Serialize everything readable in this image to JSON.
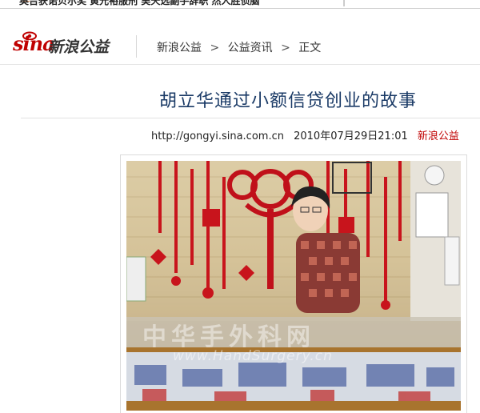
{
  "topbar": {
    "ticker": "奥吉获诺贝尔奖  黄光裕服刑  吴天选副手辞职  然人胜侦脑"
  },
  "header": {
    "logo_brand": "sina",
    "logo_cn": "新浪公益",
    "breadcrumb": {
      "home": "新浪公益",
      "sep1": ">",
      "section": "公益资讯",
      "sep2": ">",
      "current": "正文"
    }
  },
  "article": {
    "title": "胡立华通过小额信贷创业的故事",
    "url": "http://gongyi.sina.com.cn",
    "date": "2010年07月29日21:01",
    "source": "新浪公益"
  },
  "photo": {
    "watermark_cn": "中华手外科网",
    "watermark_en": "www.HandSurgery.cn"
  },
  "colors": {
    "brand_red": "#c00000",
    "title_blue": "#1a3a66"
  }
}
